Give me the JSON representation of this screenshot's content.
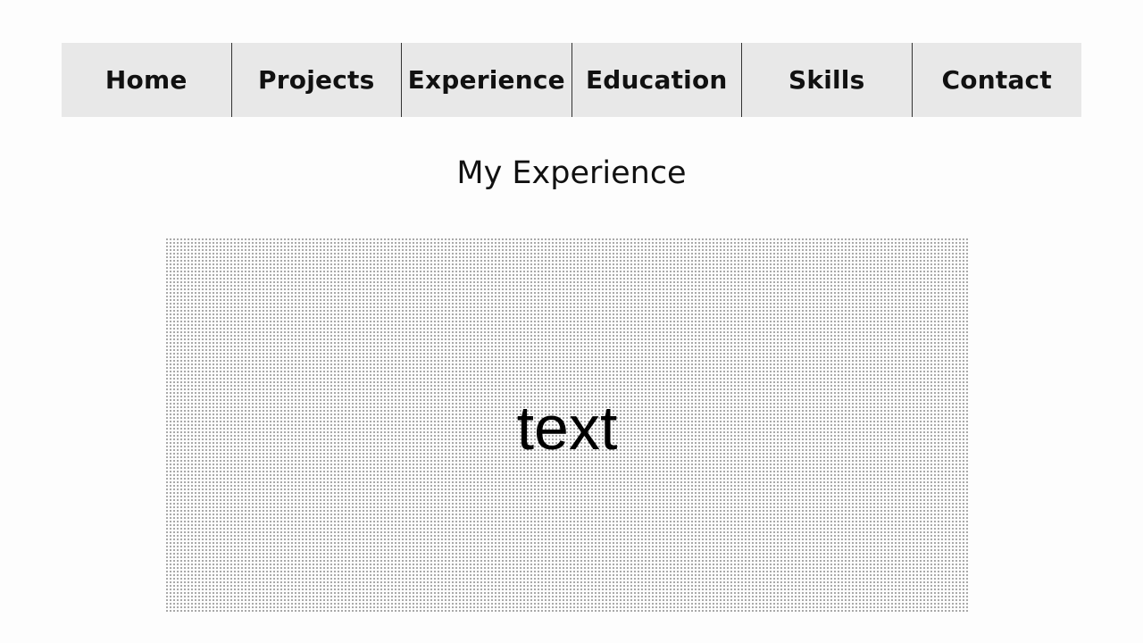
{
  "nav": {
    "items": [
      {
        "label": "Home"
      },
      {
        "label": "Projects"
      },
      {
        "label": "Experience"
      },
      {
        "label": "Education"
      },
      {
        "label": "Skills"
      },
      {
        "label": "Contact"
      }
    ]
  },
  "main": {
    "title": "My Experience",
    "content_text": "text"
  },
  "colors": {
    "nav_background": "#e8e8e8",
    "divider": "#333333",
    "text": "#111111"
  }
}
